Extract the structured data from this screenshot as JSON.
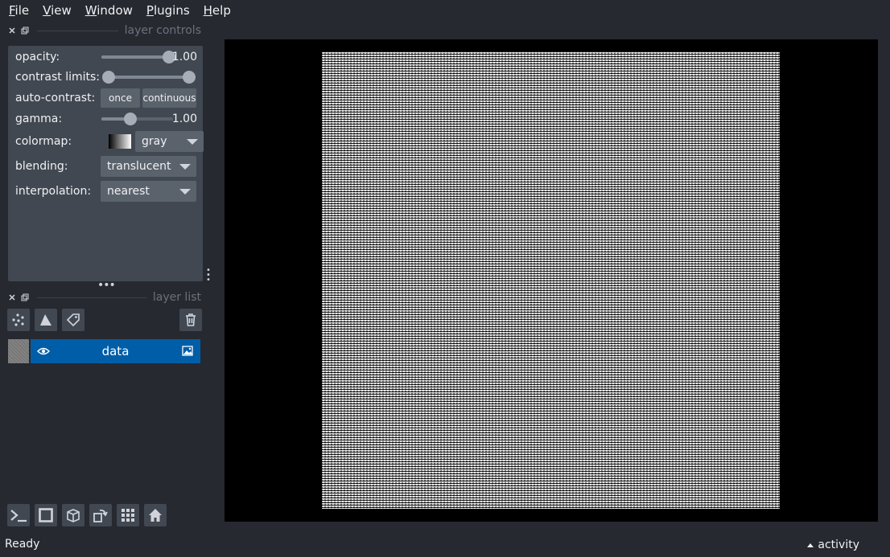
{
  "menu": {
    "items": [
      {
        "label": "File",
        "u": "F",
        "rest": "ile"
      },
      {
        "label": "View",
        "u": "V",
        "rest": "iew"
      },
      {
        "label": "Window",
        "u": "W",
        "rest": "indow"
      },
      {
        "label": "Plugins",
        "u": "P",
        "rest": "lugins"
      },
      {
        "label": "Help",
        "u": "H",
        "rest": "elp"
      }
    ]
  },
  "layer_controls": {
    "title": "layer controls",
    "opacity": {
      "label": "opacity:",
      "value": "1.00",
      "level": 1.0
    },
    "contrast": {
      "label": "contrast limits:",
      "low": 0.0,
      "high": 1.0
    },
    "auto_contrast": {
      "label": "auto-contrast:",
      "once": "once",
      "continuous": "continuous"
    },
    "gamma": {
      "label": "gamma:",
      "value": "1.00",
      "level": 0.4
    },
    "colormap": {
      "label": "colormap:",
      "value": "gray"
    },
    "blending": {
      "label": "blending:",
      "value": "translucent"
    },
    "interpolation": {
      "label": "interpolation:",
      "value": "nearest"
    }
  },
  "layer_list": {
    "title": "layer list",
    "layers": [
      {
        "name": "data",
        "visible": true
      }
    ]
  },
  "status": {
    "text": "Ready",
    "activity": "activity"
  },
  "colors": {
    "background": "#262930",
    "panel": "#414851",
    "selected_layer": "#005ea8",
    "canvas": "#000000"
  }
}
